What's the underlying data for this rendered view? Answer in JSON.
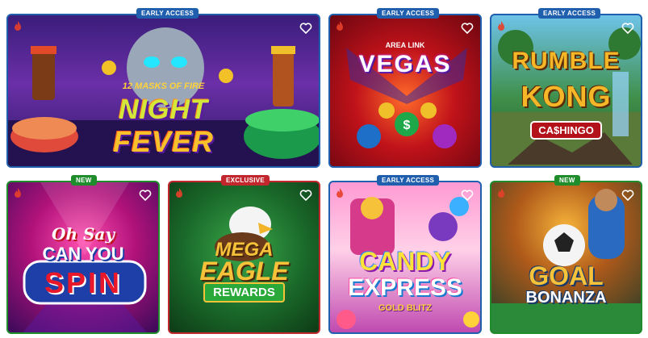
{
  "games": [
    {
      "title_line1": "12 MASKS OF FIRE",
      "title_line2": "NIGHT",
      "title_line3": "FEVER",
      "badge": "EARLY ACCESS"
    },
    {
      "title_line1": "AREA LINK",
      "title_line2": "VEGAS",
      "badge": "EARLY ACCESS"
    },
    {
      "title_line1": "RUMBLE",
      "title_line2": "KONG",
      "title_line3": "CA$HINGO",
      "badge": "EARLY ACCESS"
    },
    {
      "title_line1": "Oh Say",
      "title_line2": "CAN YOU",
      "title_line3": "SPIN",
      "badge": "NEW"
    },
    {
      "title_line1": "MEGA",
      "title_line2": "EAGLE",
      "title_line3": "REWARDS",
      "badge": "EXCLUSIVE"
    },
    {
      "title_line1": "CANDY",
      "title_line2": "EXPRESS",
      "title_line3": "GOLD BLITZ",
      "badge": "EARLY ACCESS"
    },
    {
      "title_line1": "GOAL",
      "title_line2": "BONANZA",
      "badge": "NEW"
    }
  ],
  "colors": {
    "early_access": "#1f5fae",
    "new": "#1f8d2c",
    "exclusive": "#c1272d"
  }
}
